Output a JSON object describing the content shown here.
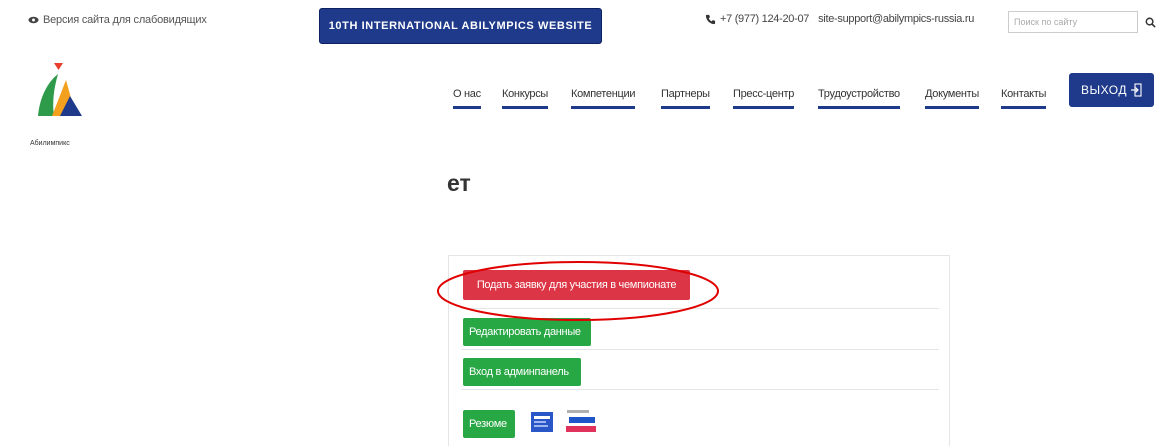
{
  "topbar": {
    "low_vision": "Версия сайта для слабовидящих",
    "intl_button": "10TH INTERNATIONAL ABILYMPICS WEBSITE",
    "phone": "+7 (977) 124-20-07",
    "email": "site-support@abilympics-russia.ru",
    "search_placeholder": "Поиск по сайту"
  },
  "logo": {
    "text": "Абилимпикс"
  },
  "nav": {
    "items": [
      {
        "label": "О нас"
      },
      {
        "label": "Конкурсы"
      },
      {
        "label": "Компетенции"
      },
      {
        "label": "Партнеры"
      },
      {
        "label": "Пресс-центр"
      },
      {
        "label": "Трудоустройство"
      },
      {
        "label": "Документы"
      },
      {
        "label": "Контакты"
      }
    ],
    "logout": "ВЫХОД"
  },
  "page": {
    "title": "ет"
  },
  "panel": {
    "apply_button": "Подать заявку для участия в чемпионате",
    "edit_button": "Редактировать данные",
    "admin_button": "Вход в админпанель",
    "resume_button": "Резюме"
  },
  "colors": {
    "brand_blue": "#1f3a8a",
    "danger_red": "#dc3545",
    "success_green": "#28a745",
    "annotation_red": "#e00000"
  },
  "icons": [
    "eye-icon",
    "phone-icon",
    "search-icon",
    "logout-icon",
    "abilympics-logo"
  ]
}
